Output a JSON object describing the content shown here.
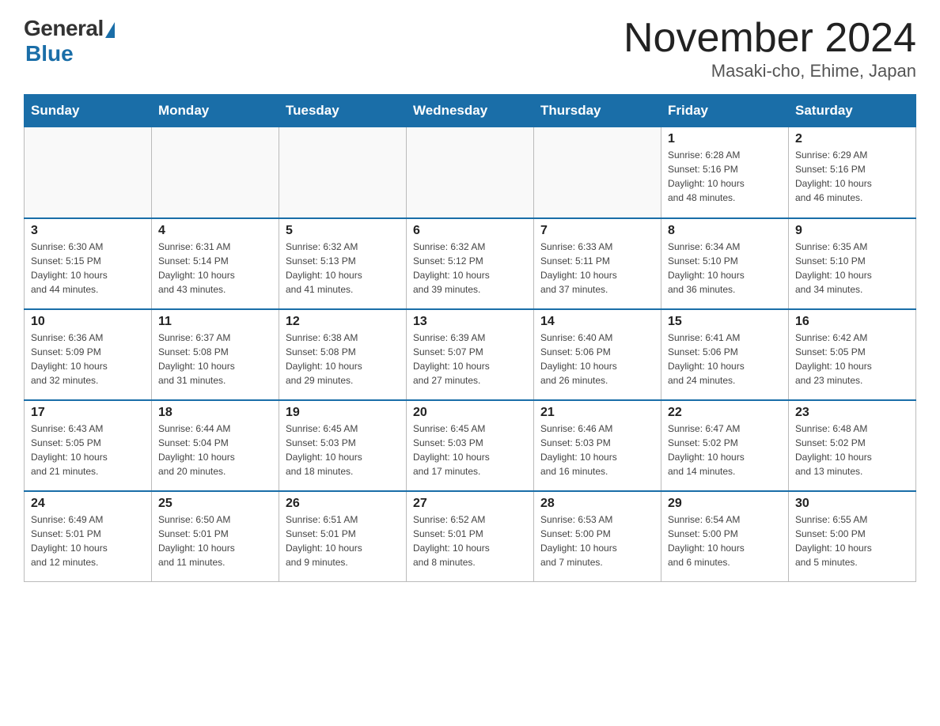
{
  "logo": {
    "general": "General",
    "blue": "Blue",
    "subtitle": "Blue"
  },
  "header": {
    "month": "November 2024",
    "location": "Masaki-cho, Ehime, Japan"
  },
  "weekdays": [
    "Sunday",
    "Monday",
    "Tuesday",
    "Wednesday",
    "Thursday",
    "Friday",
    "Saturday"
  ],
  "weeks": [
    [
      {
        "day": "",
        "info": ""
      },
      {
        "day": "",
        "info": ""
      },
      {
        "day": "",
        "info": ""
      },
      {
        "day": "",
        "info": ""
      },
      {
        "day": "",
        "info": ""
      },
      {
        "day": "1",
        "info": "Sunrise: 6:28 AM\nSunset: 5:16 PM\nDaylight: 10 hours\nand 48 minutes."
      },
      {
        "day": "2",
        "info": "Sunrise: 6:29 AM\nSunset: 5:16 PM\nDaylight: 10 hours\nand 46 minutes."
      }
    ],
    [
      {
        "day": "3",
        "info": "Sunrise: 6:30 AM\nSunset: 5:15 PM\nDaylight: 10 hours\nand 44 minutes."
      },
      {
        "day": "4",
        "info": "Sunrise: 6:31 AM\nSunset: 5:14 PM\nDaylight: 10 hours\nand 43 minutes."
      },
      {
        "day": "5",
        "info": "Sunrise: 6:32 AM\nSunset: 5:13 PM\nDaylight: 10 hours\nand 41 minutes."
      },
      {
        "day": "6",
        "info": "Sunrise: 6:32 AM\nSunset: 5:12 PM\nDaylight: 10 hours\nand 39 minutes."
      },
      {
        "day": "7",
        "info": "Sunrise: 6:33 AM\nSunset: 5:11 PM\nDaylight: 10 hours\nand 37 minutes."
      },
      {
        "day": "8",
        "info": "Sunrise: 6:34 AM\nSunset: 5:10 PM\nDaylight: 10 hours\nand 36 minutes."
      },
      {
        "day": "9",
        "info": "Sunrise: 6:35 AM\nSunset: 5:10 PM\nDaylight: 10 hours\nand 34 minutes."
      }
    ],
    [
      {
        "day": "10",
        "info": "Sunrise: 6:36 AM\nSunset: 5:09 PM\nDaylight: 10 hours\nand 32 minutes."
      },
      {
        "day": "11",
        "info": "Sunrise: 6:37 AM\nSunset: 5:08 PM\nDaylight: 10 hours\nand 31 minutes."
      },
      {
        "day": "12",
        "info": "Sunrise: 6:38 AM\nSunset: 5:08 PM\nDaylight: 10 hours\nand 29 minutes."
      },
      {
        "day": "13",
        "info": "Sunrise: 6:39 AM\nSunset: 5:07 PM\nDaylight: 10 hours\nand 27 minutes."
      },
      {
        "day": "14",
        "info": "Sunrise: 6:40 AM\nSunset: 5:06 PM\nDaylight: 10 hours\nand 26 minutes."
      },
      {
        "day": "15",
        "info": "Sunrise: 6:41 AM\nSunset: 5:06 PM\nDaylight: 10 hours\nand 24 minutes."
      },
      {
        "day": "16",
        "info": "Sunrise: 6:42 AM\nSunset: 5:05 PM\nDaylight: 10 hours\nand 23 minutes."
      }
    ],
    [
      {
        "day": "17",
        "info": "Sunrise: 6:43 AM\nSunset: 5:05 PM\nDaylight: 10 hours\nand 21 minutes."
      },
      {
        "day": "18",
        "info": "Sunrise: 6:44 AM\nSunset: 5:04 PM\nDaylight: 10 hours\nand 20 minutes."
      },
      {
        "day": "19",
        "info": "Sunrise: 6:45 AM\nSunset: 5:03 PM\nDaylight: 10 hours\nand 18 minutes."
      },
      {
        "day": "20",
        "info": "Sunrise: 6:45 AM\nSunset: 5:03 PM\nDaylight: 10 hours\nand 17 minutes."
      },
      {
        "day": "21",
        "info": "Sunrise: 6:46 AM\nSunset: 5:03 PM\nDaylight: 10 hours\nand 16 minutes."
      },
      {
        "day": "22",
        "info": "Sunrise: 6:47 AM\nSunset: 5:02 PM\nDaylight: 10 hours\nand 14 minutes."
      },
      {
        "day": "23",
        "info": "Sunrise: 6:48 AM\nSunset: 5:02 PM\nDaylight: 10 hours\nand 13 minutes."
      }
    ],
    [
      {
        "day": "24",
        "info": "Sunrise: 6:49 AM\nSunset: 5:01 PM\nDaylight: 10 hours\nand 12 minutes."
      },
      {
        "day": "25",
        "info": "Sunrise: 6:50 AM\nSunset: 5:01 PM\nDaylight: 10 hours\nand 11 minutes."
      },
      {
        "day": "26",
        "info": "Sunrise: 6:51 AM\nSunset: 5:01 PM\nDaylight: 10 hours\nand 9 minutes."
      },
      {
        "day": "27",
        "info": "Sunrise: 6:52 AM\nSunset: 5:01 PM\nDaylight: 10 hours\nand 8 minutes."
      },
      {
        "day": "28",
        "info": "Sunrise: 6:53 AM\nSunset: 5:00 PM\nDaylight: 10 hours\nand 7 minutes."
      },
      {
        "day": "29",
        "info": "Sunrise: 6:54 AM\nSunset: 5:00 PM\nDaylight: 10 hours\nand 6 minutes."
      },
      {
        "day": "30",
        "info": "Sunrise: 6:55 AM\nSunset: 5:00 PM\nDaylight: 10 hours\nand 5 minutes."
      }
    ]
  ]
}
